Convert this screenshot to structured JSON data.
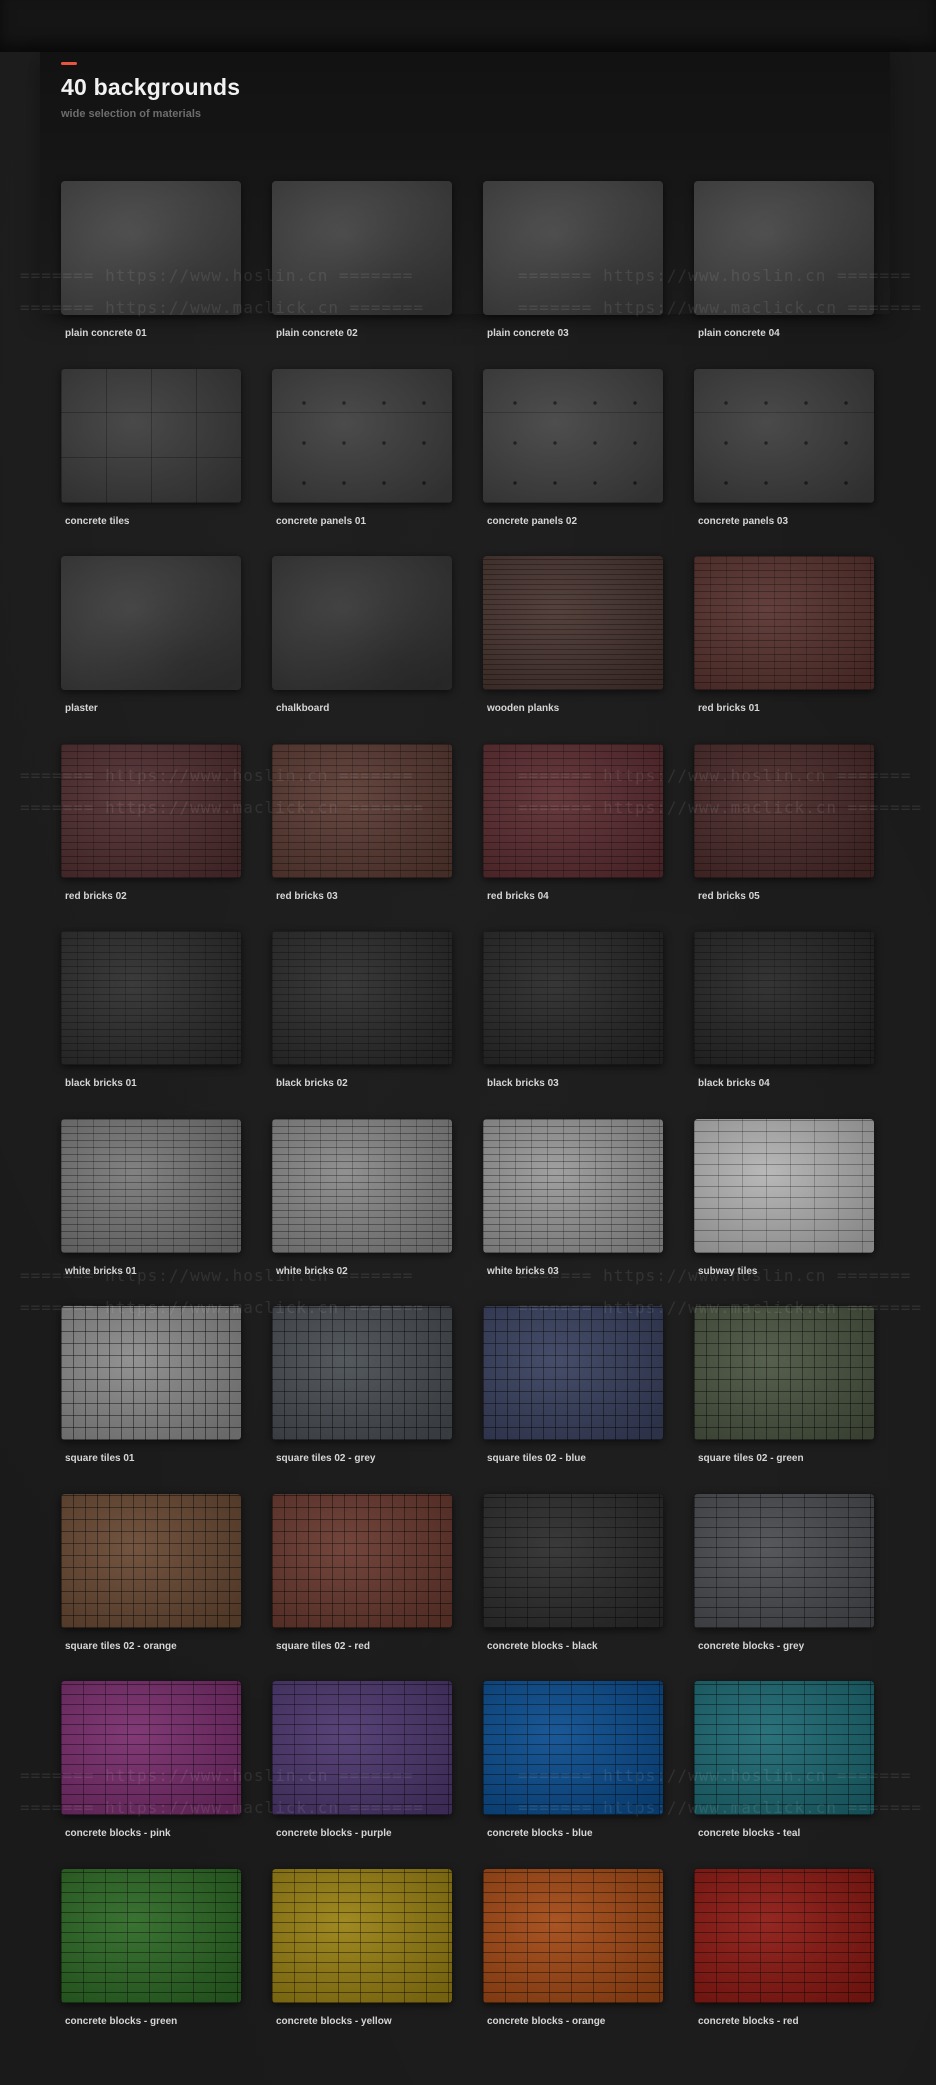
{
  "header": {
    "title": "40 backgrounds",
    "subtitle": "wide selection of materials",
    "accent_color": "#e8553f"
  },
  "watermarks": [
    "======= https://www.hoslin.cn =======",
    "======= https://www.maclick.cn ======="
  ],
  "items": [
    {
      "label": "plain concrete 01",
      "color": "#474747",
      "pattern": "plain"
    },
    {
      "label": "plain concrete 02",
      "color": "#444444",
      "pattern": "plain"
    },
    {
      "label": "plain concrete 03",
      "color": "#464646",
      "pattern": "plain"
    },
    {
      "label": "plain concrete 04",
      "color": "#474747",
      "pattern": "plain"
    },
    {
      "label": "concrete tiles",
      "color": "#3e3e3e",
      "pattern": "tiles"
    },
    {
      "label": "concrete panels 01",
      "color": "#404040",
      "pattern": "panels"
    },
    {
      "label": "concrete panels 02",
      "color": "#434343",
      "pattern": "panels"
    },
    {
      "label": "concrete panels 03",
      "color": "#3f3f3f",
      "pattern": "panels"
    },
    {
      "label": "plaster",
      "color": "#3d3d3d",
      "pattern": "plain"
    },
    {
      "label": "chalkboard",
      "color": "#393939",
      "pattern": "plain"
    },
    {
      "label": "wooden planks",
      "color": "#4a3631",
      "pattern": "planks"
    },
    {
      "label": "red bricks 01",
      "color": "#5a3430",
      "pattern": "bricks"
    },
    {
      "label": "red bricks 02",
      "color": "#533032",
      "pattern": "bricks"
    },
    {
      "label": "red bricks 03",
      "color": "#5c3c34",
      "pattern": "bricks"
    },
    {
      "label": "red bricks 04",
      "color": "#5e2e32",
      "pattern": "bricks"
    },
    {
      "label": "red bricks 05",
      "color": "#4c2c2b",
      "pattern": "bricks"
    },
    {
      "label": "black bricks 01",
      "color": "#2f2f2f",
      "pattern": "bricks"
    },
    {
      "label": "black bricks 02",
      "color": "#2d2d2d",
      "pattern": "bricks"
    },
    {
      "label": "black bricks 03",
      "color": "#2a2a2a",
      "pattern": "bricks"
    },
    {
      "label": "black bricks 04",
      "color": "#282828",
      "pattern": "bricks"
    },
    {
      "label": "white bricks 01",
      "color": "#7a7a7a",
      "pattern": "bricks"
    },
    {
      "label": "white bricks 02",
      "color": "#8a8a8a",
      "pattern": "bricks"
    },
    {
      "label": "white bricks 03",
      "color": "#9a9a9a",
      "pattern": "bricks"
    },
    {
      "label": "subway tiles",
      "color": "#b4b4b4",
      "pattern": "subway"
    },
    {
      "label": "square tiles 01",
      "color": "#8c8c8c",
      "pattern": "squares"
    },
    {
      "label": "square tiles 02 - grey",
      "color": "#4a4f55",
      "pattern": "squares"
    },
    {
      "label": "square tiles 02 - blue",
      "color": "#3a4260",
      "pattern": "squares"
    },
    {
      "label": "square tiles 02 - green",
      "color": "#4c5643",
      "pattern": "squares"
    },
    {
      "label": "square tiles 02 - orange",
      "color": "#6a4a34",
      "pattern": "squares"
    },
    {
      "label": "square tiles 02 - red",
      "color": "#6a3a30",
      "pattern": "squares"
    },
    {
      "label": "concrete blocks - black",
      "color": "#2e2e2e",
      "pattern": "blocks"
    },
    {
      "label": "concrete blocks - grey",
      "color": "#4c4e52",
      "pattern": "blocks"
    },
    {
      "label": "concrete blocks - pink",
      "color": "#7a2e6e",
      "pattern": "blocks"
    },
    {
      "label": "concrete blocks - purple",
      "color": "#4e3870",
      "pattern": "blocks"
    },
    {
      "label": "concrete blocks - blue",
      "color": "#0c4e90",
      "pattern": "blocks"
    },
    {
      "label": "concrete blocks - teal",
      "color": "#1e6a74",
      "pattern": "blocks"
    },
    {
      "label": "concrete blocks - green",
      "color": "#2e6a26",
      "pattern": "blocks"
    },
    {
      "label": "concrete blocks - yellow",
      "color": "#9a8214",
      "pattern": "blocks"
    },
    {
      "label": "concrete blocks - orange",
      "color": "#a44a16",
      "pattern": "blocks"
    },
    {
      "label": "concrete blocks - red",
      "color": "#8e1a14",
      "pattern": "blocks"
    }
  ]
}
